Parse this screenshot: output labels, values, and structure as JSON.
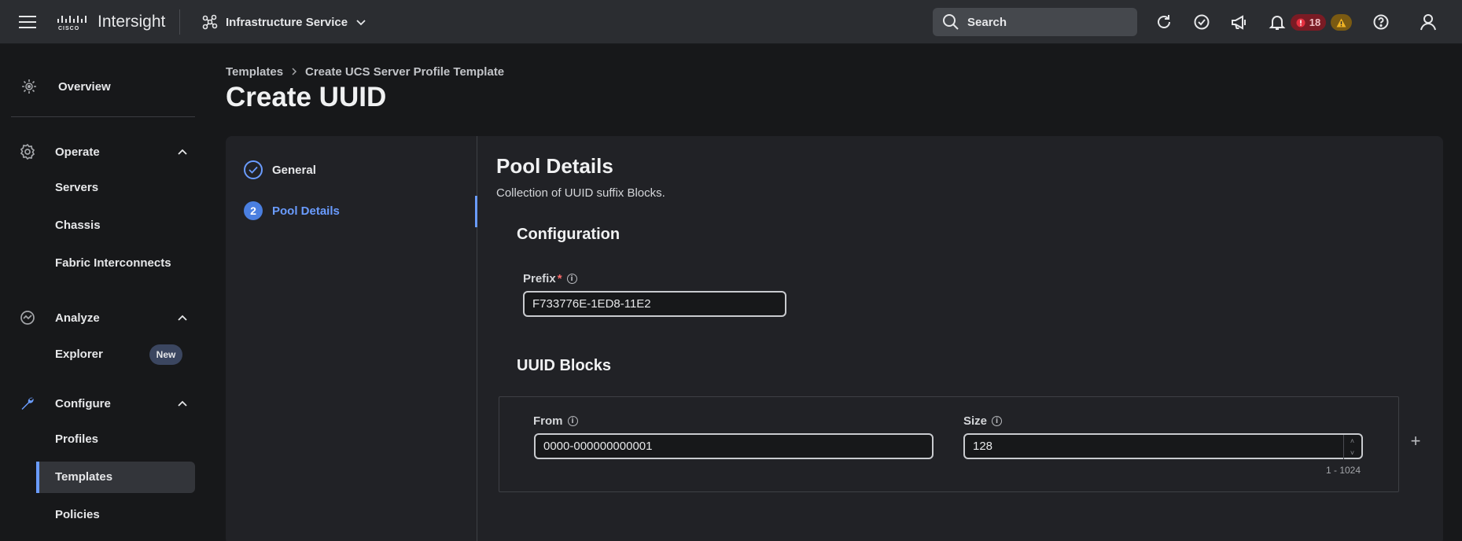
{
  "app": {
    "name": "Intersight",
    "service": "Infrastructure Service"
  },
  "search": {
    "placeholder": "Search"
  },
  "alerts": {
    "critical_count": "18"
  },
  "sidebar": {
    "overview": "Overview",
    "operate": {
      "label": "Operate",
      "items": [
        "Servers",
        "Chassis",
        "Fabric Interconnects"
      ]
    },
    "analyze": {
      "label": "Analyze",
      "items": [
        "Explorer"
      ],
      "explorer_badge": "New"
    },
    "configure": {
      "label": "Configure",
      "items": [
        "Profiles",
        "Templates",
        "Policies"
      ],
      "selected": "Templates"
    }
  },
  "breadcrumb": {
    "items": [
      "Templates",
      "Create UCS Server Profile Template"
    ]
  },
  "page_title": "Create UUID",
  "wizard": {
    "steps": [
      {
        "label": "General",
        "state": "complete"
      },
      {
        "label": "Pool Details",
        "number": "2",
        "state": "active"
      }
    ]
  },
  "pool_details": {
    "title": "Pool Details",
    "description": "Collection of UUID suffix Blocks.",
    "configuration_title": "Configuration",
    "prefix_label": "Prefix",
    "prefix_required": "*",
    "prefix_value": "F733776E-1ED8-11E2",
    "uuid_blocks_title": "UUID Blocks",
    "from_label": "From",
    "from_value": "0000-000000000001",
    "size_label": "Size",
    "size_value": "128",
    "size_range": "1 - 1024"
  },
  "colors": {
    "accent": "#6a9cff",
    "critical": "#e5303f",
    "warning": "#f0b323"
  }
}
